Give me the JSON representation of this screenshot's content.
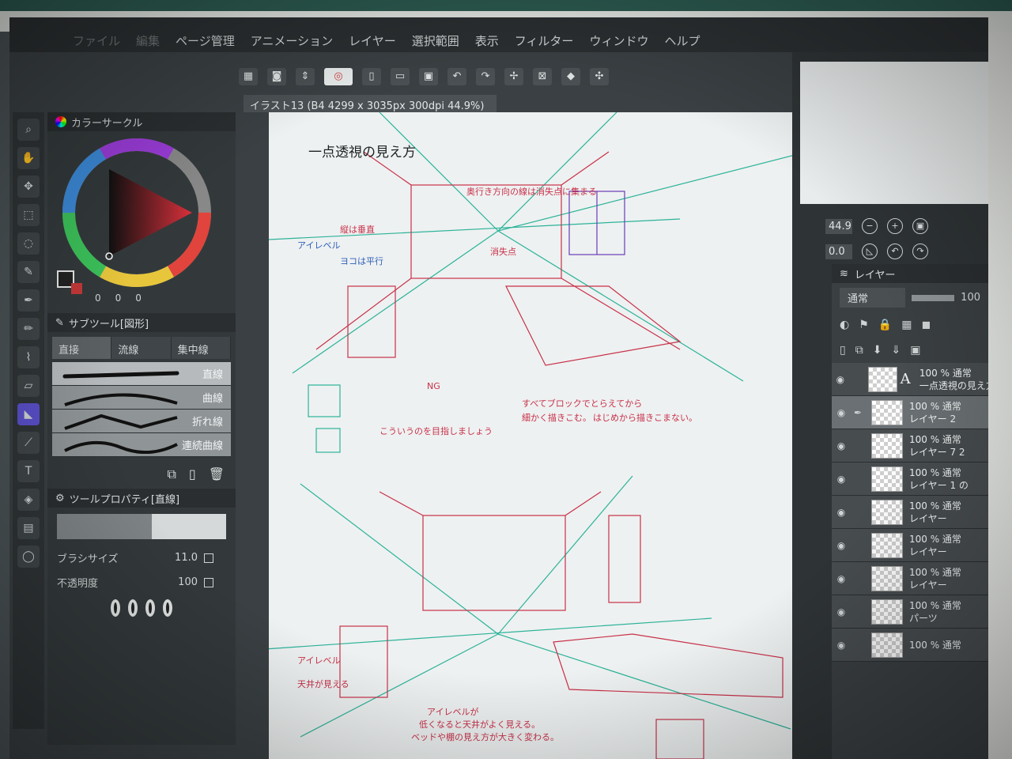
{
  "menubar": {
    "items": [
      {
        "label": "ファイル",
        "dim": true
      },
      {
        "label": "編集",
        "dim": true
      },
      {
        "label": "ページ管理",
        "dim": false
      },
      {
        "label": "アニメーション",
        "dim": false
      },
      {
        "label": "レイヤー",
        "dim": false
      },
      {
        "label": "選択範囲",
        "dim": false
      },
      {
        "label": "表示",
        "dim": false
      },
      {
        "label": "フィルター",
        "dim": false
      },
      {
        "label": "ウィンドウ",
        "dim": false
      },
      {
        "label": "ヘルプ",
        "dim": false
      }
    ]
  },
  "canvas_tab": {
    "title": "イラスト13 (B4 4299 x 3035px 300dpi 44.9%)"
  },
  "color_panel": {
    "title": "カラーサークル",
    "values": [
      "0",
      "0",
      "0"
    ],
    "accent_color": "#c43838"
  },
  "subtool_panel": {
    "title": "サブツール[図形]",
    "tabs": [
      "直接",
      "流線",
      "集中線"
    ],
    "brushes": [
      {
        "label": "直線",
        "selected": true
      },
      {
        "label": "曲線",
        "selected": false
      },
      {
        "label": "折れ線",
        "selected": false
      },
      {
        "label": "連続曲線",
        "selected": false
      }
    ]
  },
  "tool_property": {
    "title": "ツールプロパティ[直線]",
    "brush_size_label": "ブラシサイズ",
    "brush_size_value": "11.0",
    "opacity_label": "不透明度",
    "opacity_value": "100"
  },
  "canvas": {
    "heading": "一点透視の見え方",
    "notes_red": [
      "奥行き方向の線は消失点に集まる",
      "縦は垂直",
      "消失点",
      "すべてブロックでとらえてから",
      "細かく描きこむ。",
      "はじめから描きこまない。",
      "アイレベルが",
      "低くなると天井がよく見える。",
      "ベッドや棚の見え方が大きく変わる。",
      "こういうのを目指しましょう",
      "NG",
      "アイレベル",
      "天井が見える"
    ],
    "notes_blue": [
      "アイレベル",
      "ヨコは平行"
    ]
  },
  "navigator": {
    "zoom": "44.9",
    "rotation": "0.0"
  },
  "layer_panel": {
    "title": "レイヤー",
    "blend_mode": "通常",
    "opacity": "100",
    "layers": [
      {
        "line1": "100 % 通常",
        "line2": "一点透視の見え方",
        "type": "text",
        "selected": false
      },
      {
        "line1": "100 % 通常",
        "line2": "レイヤー 2",
        "type": "raster",
        "selected": true
      },
      {
        "line1": "100 % 通常",
        "line2": "レイヤー 7 2",
        "type": "raster",
        "selected": false
      },
      {
        "line1": "100 % 通常",
        "line2": "レイヤー 1 の",
        "type": "raster",
        "selected": false
      },
      {
        "line1": "100 % 通常",
        "line2": "レイヤー",
        "type": "raster",
        "selected": false
      },
      {
        "line1": "100 % 通常",
        "line2": "レイヤー",
        "type": "raster",
        "selected": false
      },
      {
        "line1": "100 % 通常",
        "line2": "レイヤー",
        "type": "raster",
        "selected": false
      },
      {
        "line1": "100 % 通常",
        "line2": "パーツ",
        "type": "raster",
        "selected": false
      },
      {
        "line1": "100 % 通常",
        "line2": "",
        "type": "raster",
        "selected": false
      }
    ]
  },
  "colors": {
    "accent_violet": "#5a4fc9",
    "sketch_red": "#c8314a",
    "sketch_teal": "#2bb39a",
    "sketch_blue": "#2c5fb8"
  }
}
